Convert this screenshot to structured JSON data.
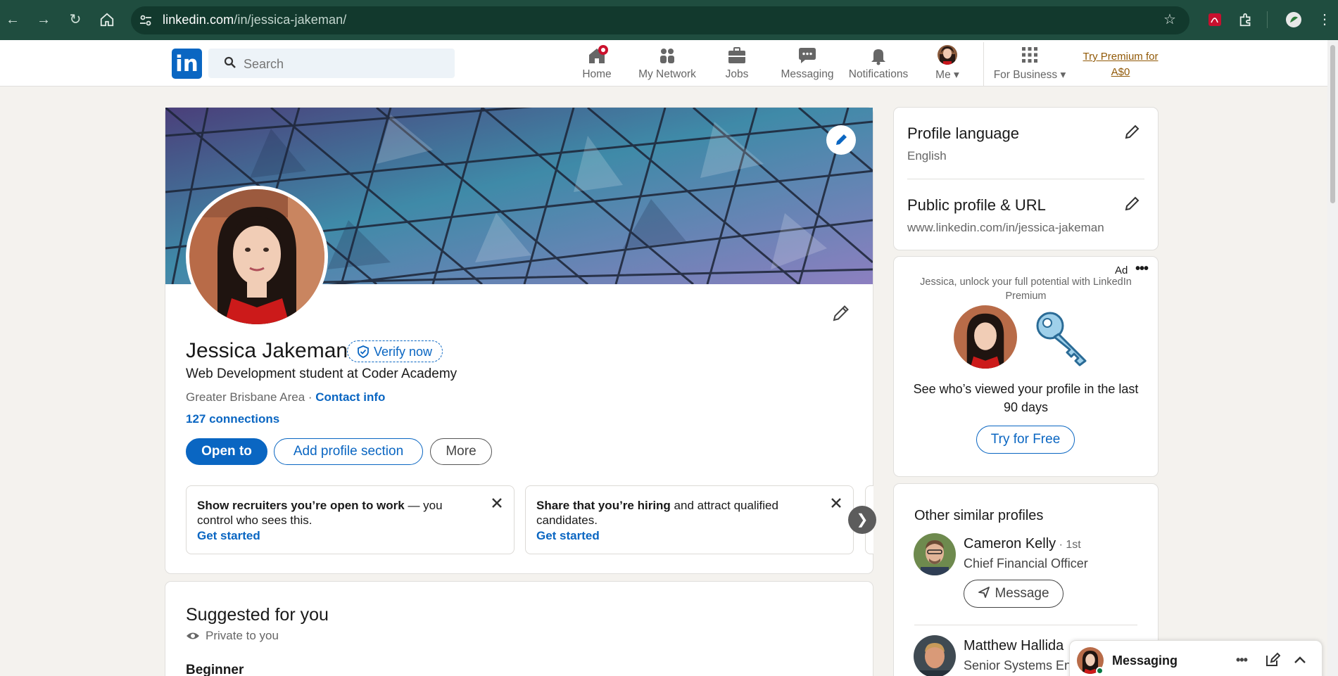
{
  "browser": {
    "url_domain": "linkedin.com",
    "url_path": "/in/jessica-jakeman/",
    "back_icon": "arrow-left-icon",
    "forward_icon": "arrow-right-icon",
    "reload_icon": "reload-icon",
    "home_icon": "home-icon"
  },
  "header": {
    "logo": "in",
    "search_placeholder": "Search",
    "nav": [
      {
        "label": "Home",
        "icon": "home-icon",
        "badge": true
      },
      {
        "label": "My Network",
        "icon": "network-icon"
      },
      {
        "label": "Jobs",
        "icon": "briefcase-icon"
      },
      {
        "label": "Messaging",
        "icon": "chat-icon"
      },
      {
        "label": "Notifications",
        "icon": "bell-icon"
      },
      {
        "label": "Me",
        "icon": "avatar"
      },
      {
        "label": "For Business",
        "icon": "grid-icon"
      }
    ],
    "premium_line1": "Try Premium for",
    "premium_line2": "A$0"
  },
  "profile": {
    "name": "Jessica Jakeman",
    "verify_label": "Verify now",
    "headline": "Web Development student at Coder Academy",
    "location": "Greater Brisbane Area",
    "separator": " · ",
    "contact_info": "Contact info",
    "connections": "127 connections",
    "btn_open": "Open to",
    "btn_add": "Add profile section",
    "btn_more": "More"
  },
  "promos": [
    {
      "bold": "Show recruiters you’re open to work",
      "rest": " — you control who sees this.",
      "link": "Get started"
    },
    {
      "bold": "Share that you’re hiring",
      "rest": " and attract qualified candidates.",
      "link": "Get started"
    }
  ],
  "suggested": {
    "title": "Suggested for you",
    "privacy": "Private to you",
    "level": "Beginner"
  },
  "settings": {
    "language_title": "Profile language",
    "language_value": "English",
    "url_title": "Public profile & URL",
    "url_value": "www.linkedin.com/in/jessica-jakeman"
  },
  "ad": {
    "label": "Ad",
    "menu": "•••",
    "lead": "Jessica, unlock your full potential with LinkedIn Premium",
    "body": "See who’s viewed your profile in the last 90 days",
    "cta": "Try for Free"
  },
  "similar": {
    "title": "Other similar profiles",
    "people": [
      {
        "name": "Cameron Kelly",
        "degree": " · 1st",
        "role": "Chief Financial Officer"
      },
      {
        "name": "Matthew Hallida",
        "degree": "",
        "role": "Senior Systems Eng"
      }
    ],
    "message_label": "Message"
  },
  "messaging": {
    "label": "Messaging",
    "menu": "•••"
  },
  "colors": {
    "brand": "#0a66c2",
    "chrome": "#1f4d3f",
    "notification": "#cb112d",
    "premium": "#915907"
  }
}
